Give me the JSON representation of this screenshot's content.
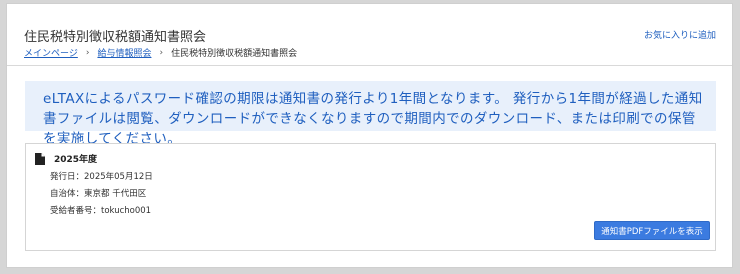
{
  "header": {
    "title": "住民税特別徴収税額通知書照会",
    "favorite_link": "お気に入りに追加",
    "breadcrumb": {
      "home": "メインページ",
      "salary": "給与情報照会",
      "current": "住民税特別徴収税額通知書照会",
      "separator": "›"
    }
  },
  "notice": {
    "text": "eLTAXによるパスワード確認の期限は通知書の発行より1年間となります。 発行から1年間が経過した通知書ファイルは閲覧、ダウンロードができなくなりますので期間内でのダウンロード、または印刷での保管を実施してください。"
  },
  "card": {
    "icon": "document-icon",
    "year": "2025年度",
    "issue_date": "発行日：2025年05月12日",
    "municipality": "自治体：東京都 千代田区",
    "recipient_number": "受給者番号：tokucho001",
    "pdf_button": "通知書PDFファイルを表示"
  },
  "colors": {
    "link": "#1f5fbf",
    "notice_bg": "#e8f0fb",
    "button_bg": "#3b7be0"
  }
}
